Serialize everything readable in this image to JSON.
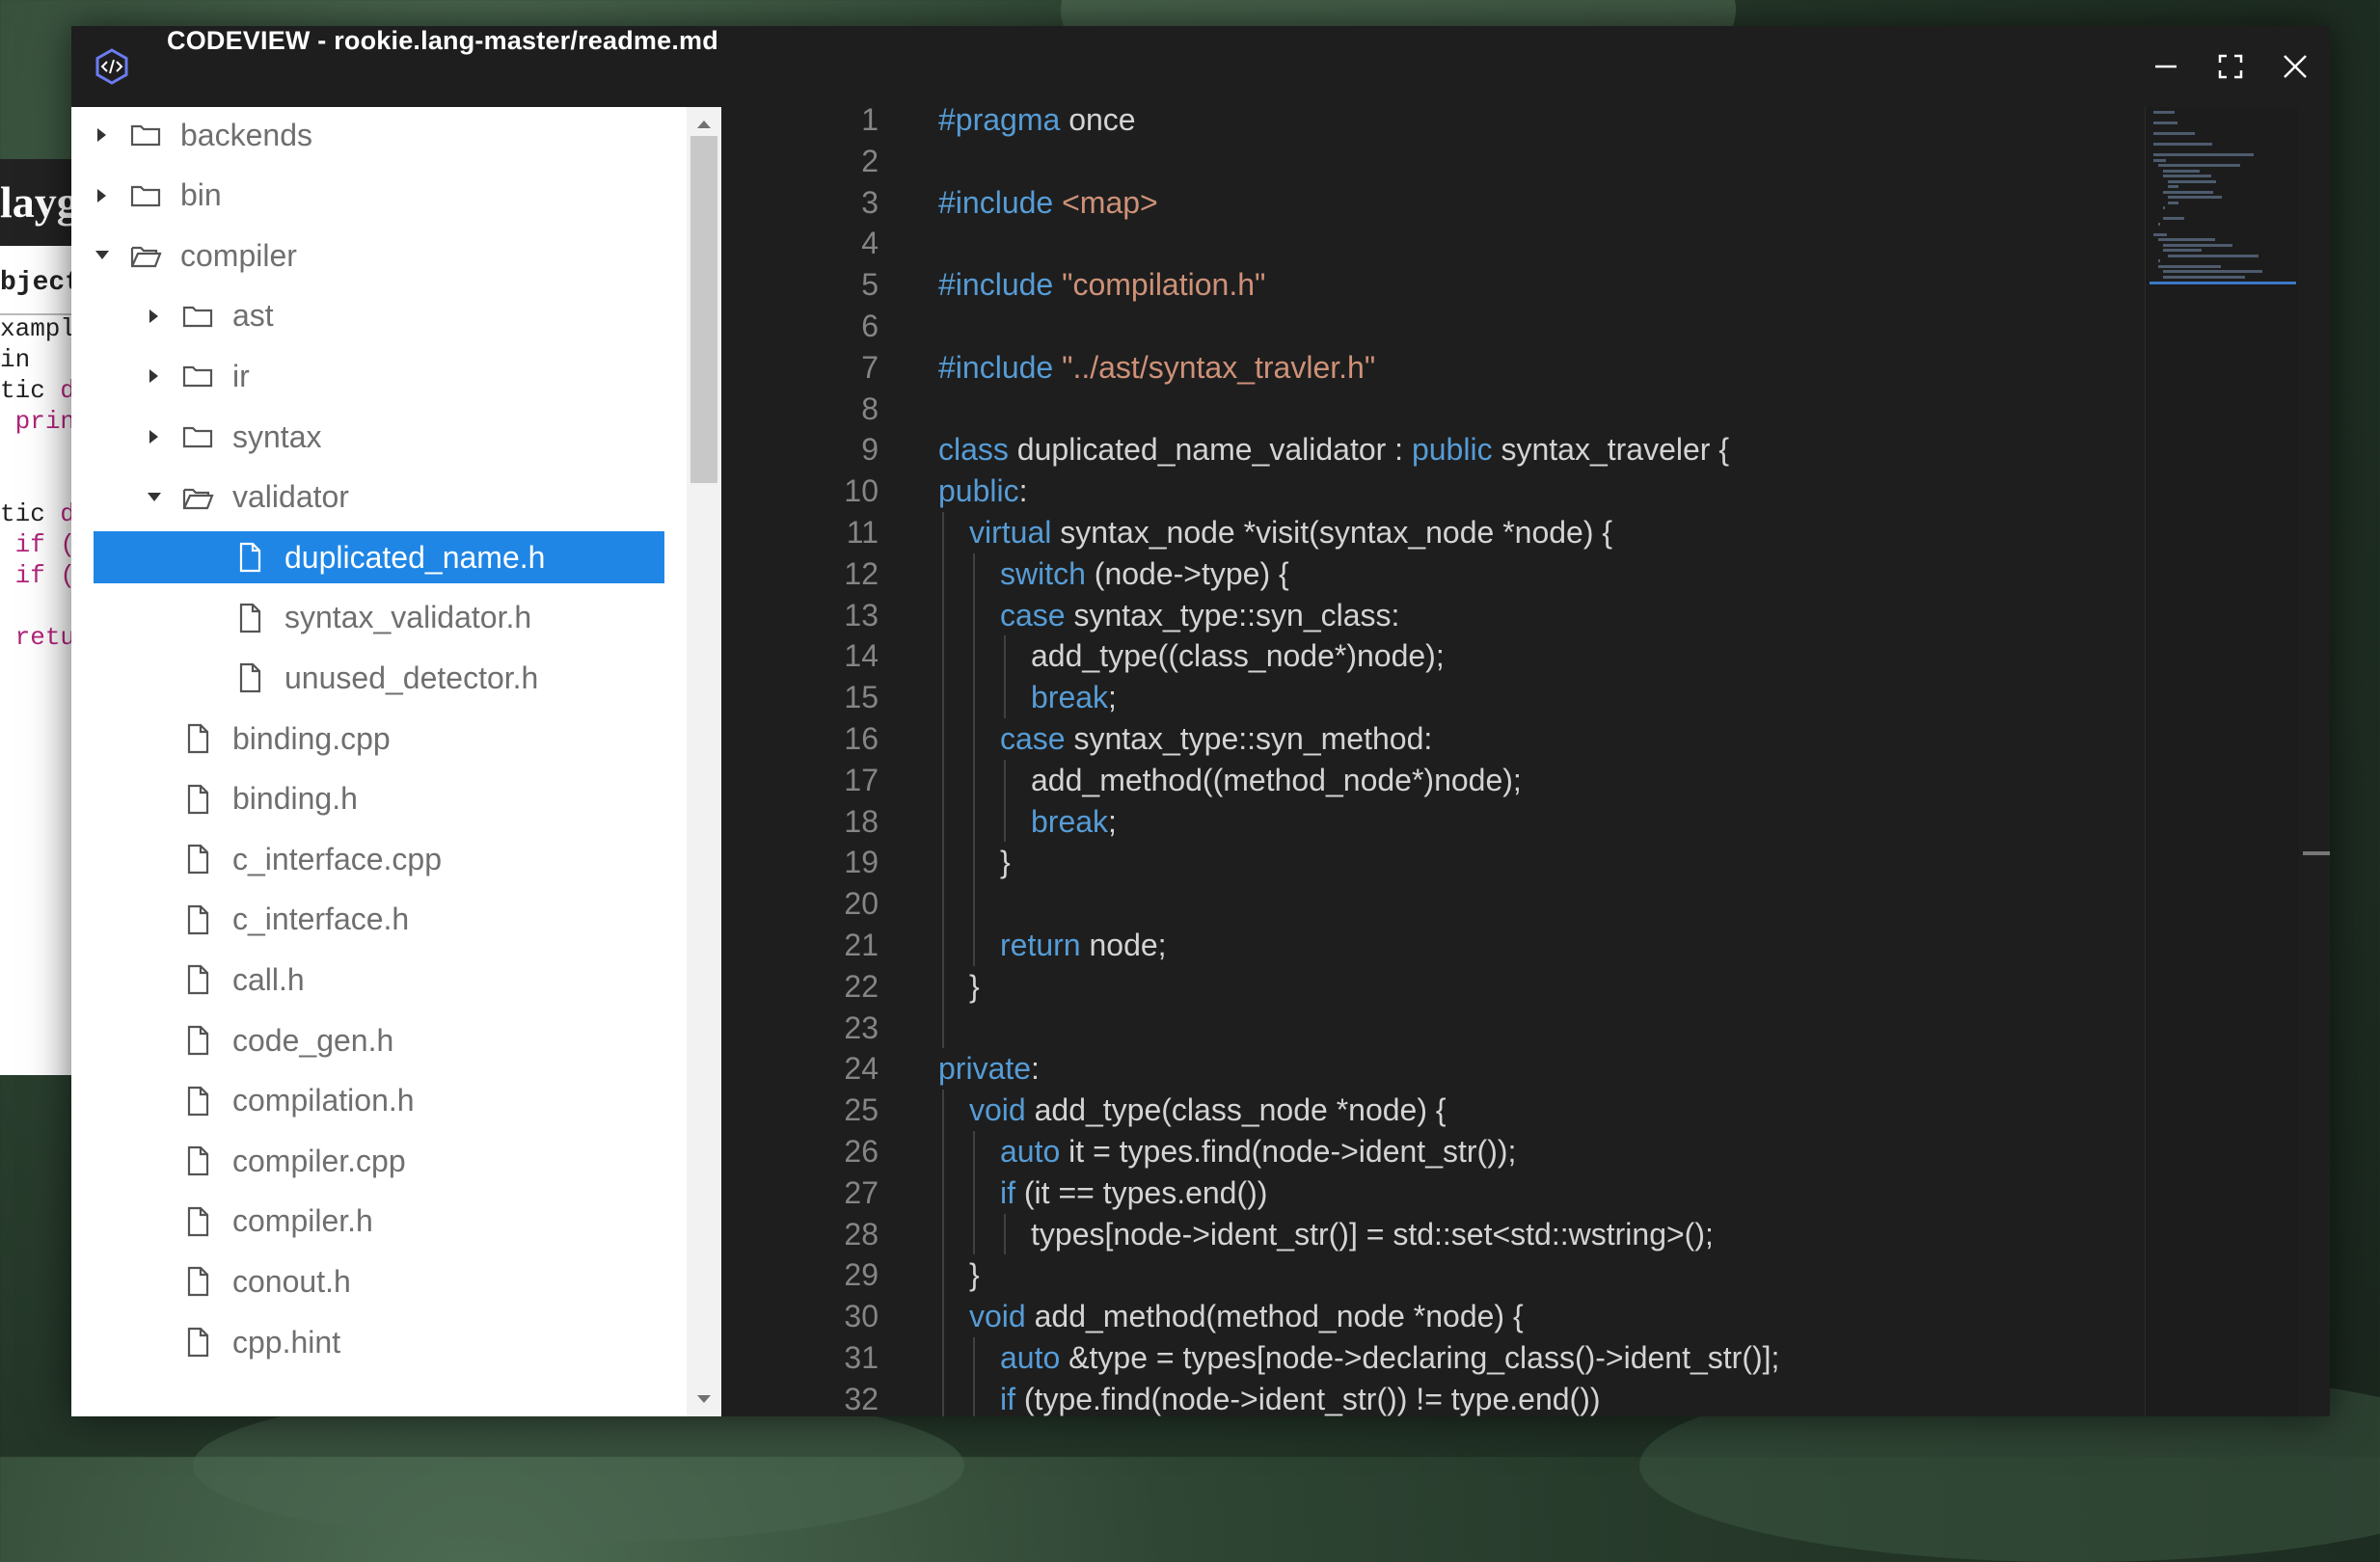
{
  "window": {
    "title": "CODEVIEW - rookie.lang-master/readme.md",
    "app_icon": "code-hexagon-icon",
    "buttons": [
      "minimize-icon",
      "maximize-icon",
      "close-icon"
    ]
  },
  "background_window": {
    "title_fragment": "layg",
    "tab_fragment": "bject",
    "code_lines": [
      {
        "a": "xampl",
        "b": ""
      },
      {
        "a": "in",
        "b": ""
      },
      {
        "a": "tic ",
        "b": "d"
      },
      {
        "a": " ",
        "b": "prin"
      },
      {
        "a": "",
        "b": ""
      },
      {
        "a": "",
        "b": ""
      },
      {
        "a": "tic ",
        "b": "d"
      },
      {
        "a": " ",
        "b": "if ("
      },
      {
        "a": " ",
        "b": "if ("
      },
      {
        "a": "",
        "b": ""
      },
      {
        "a": " ",
        "b": "retu"
      }
    ]
  },
  "file_tree": {
    "items": [
      {
        "label": "backends",
        "type": "folder",
        "expanded": false,
        "depth": 0
      },
      {
        "label": "bin",
        "type": "folder",
        "expanded": false,
        "depth": 0
      },
      {
        "label": "compiler",
        "type": "folder",
        "expanded": true,
        "depth": 0
      },
      {
        "label": "ast",
        "type": "folder",
        "expanded": false,
        "depth": 1
      },
      {
        "label": "ir",
        "type": "folder",
        "expanded": false,
        "depth": 1
      },
      {
        "label": "syntax",
        "type": "folder",
        "expanded": false,
        "depth": 1
      },
      {
        "label": "validator",
        "type": "folder",
        "expanded": true,
        "depth": 1
      },
      {
        "label": "duplicated_name.h",
        "type": "file",
        "depth": 2,
        "selected": true
      },
      {
        "label": "syntax_validator.h",
        "type": "file",
        "depth": 2
      },
      {
        "label": "unused_detector.h",
        "type": "file",
        "depth": 2
      },
      {
        "label": "binding.cpp",
        "type": "file",
        "depth": 1
      },
      {
        "label": "binding.h",
        "type": "file",
        "depth": 1
      },
      {
        "label": "c_interface.cpp",
        "type": "file",
        "depth": 1
      },
      {
        "label": "c_interface.h",
        "type": "file",
        "depth": 1
      },
      {
        "label": "call.h",
        "type": "file",
        "depth": 1
      },
      {
        "label": "code_gen.h",
        "type": "file",
        "depth": 1
      },
      {
        "label": "compilation.h",
        "type": "file",
        "depth": 1
      },
      {
        "label": "compiler.cpp",
        "type": "file",
        "depth": 1
      },
      {
        "label": "compiler.h",
        "type": "file",
        "depth": 1
      },
      {
        "label": "conout.h",
        "type": "file",
        "depth": 1
      },
      {
        "label": "cpp.hint",
        "type": "file",
        "depth": 1
      }
    ]
  },
  "editor": {
    "lines": [
      {
        "n": "1",
        "indent": 0,
        "tokens": [
          [
            "kw",
            "#pragma"
          ],
          [
            "txt",
            " once"
          ]
        ]
      },
      {
        "n": "2",
        "indent": 0,
        "tokens": []
      },
      {
        "n": "3",
        "indent": 0,
        "tokens": [
          [
            "kw",
            "#include"
          ],
          [
            "txt",
            " "
          ],
          [
            "str",
            "<map>"
          ]
        ]
      },
      {
        "n": "4",
        "indent": 0,
        "tokens": []
      },
      {
        "n": "5",
        "indent": 0,
        "tokens": [
          [
            "kw",
            "#include"
          ],
          [
            "txt",
            " "
          ],
          [
            "str",
            "\"compilation.h\""
          ]
        ]
      },
      {
        "n": "6",
        "indent": 0,
        "tokens": []
      },
      {
        "n": "7",
        "indent": 0,
        "tokens": [
          [
            "kw",
            "#include"
          ],
          [
            "txt",
            " "
          ],
          [
            "str",
            "\"../ast/syntax_travler.h\""
          ]
        ]
      },
      {
        "n": "8",
        "indent": 0,
        "tokens": []
      },
      {
        "n": "9",
        "indent": 0,
        "tokens": [
          [
            "kw",
            "class"
          ],
          [
            "txt",
            " duplicated_name_validator : "
          ],
          [
            "kw",
            "public"
          ],
          [
            "txt",
            " syntax_traveler {"
          ]
        ]
      },
      {
        "n": "10",
        "indent": 0,
        "tokens": [
          [
            "kw",
            "public"
          ],
          [
            "txt",
            ":"
          ]
        ]
      },
      {
        "n": "11",
        "indent": 1,
        "tokens": [
          [
            "kw",
            "virtual"
          ],
          [
            "txt",
            " syntax_node *visit(syntax_node *node) {"
          ]
        ]
      },
      {
        "n": "12",
        "indent": 2,
        "tokens": [
          [
            "kw",
            "switch"
          ],
          [
            "txt",
            " (node->type) {"
          ]
        ]
      },
      {
        "n": "13",
        "indent": 2,
        "tokens": [
          [
            "kw",
            "case"
          ],
          [
            "txt",
            " syntax_type::syn_class:"
          ]
        ]
      },
      {
        "n": "14",
        "indent": 3,
        "tokens": [
          [
            "txt",
            "add_type((class_node*)node);"
          ]
        ]
      },
      {
        "n": "15",
        "indent": 3,
        "tokens": [
          [
            "kw",
            "break"
          ],
          [
            "txt",
            ";"
          ]
        ]
      },
      {
        "n": "16",
        "indent": 2,
        "tokens": [
          [
            "kw",
            "case"
          ],
          [
            "txt",
            " syntax_type::syn_method:"
          ]
        ]
      },
      {
        "n": "17",
        "indent": 3,
        "tokens": [
          [
            "txt",
            "add_method((method_node*)node);"
          ]
        ]
      },
      {
        "n": "18",
        "indent": 3,
        "tokens": [
          [
            "kw",
            "break"
          ],
          [
            "txt",
            ";"
          ]
        ]
      },
      {
        "n": "19",
        "indent": 2,
        "tokens": [
          [
            "txt",
            "}"
          ]
        ]
      },
      {
        "n": "20",
        "indent": 2,
        "tokens": []
      },
      {
        "n": "21",
        "indent": 2,
        "tokens": [
          [
            "kw",
            "return"
          ],
          [
            "txt",
            " node;"
          ]
        ]
      },
      {
        "n": "22",
        "indent": 1,
        "tokens": [
          [
            "txt",
            "}"
          ]
        ]
      },
      {
        "n": "23",
        "indent": 1,
        "tokens": []
      },
      {
        "n": "24",
        "indent": 0,
        "tokens": [
          [
            "kw",
            "private"
          ],
          [
            "txt",
            ":"
          ]
        ]
      },
      {
        "n": "25",
        "indent": 1,
        "tokens": [
          [
            "kw",
            "void"
          ],
          [
            "txt",
            " add_type(class_node *node) {"
          ]
        ]
      },
      {
        "n": "26",
        "indent": 2,
        "tokens": [
          [
            "kw",
            "auto"
          ],
          [
            "txt",
            " it = types.find(node->ident_str());"
          ]
        ]
      },
      {
        "n": "27",
        "indent": 2,
        "tokens": [
          [
            "kw",
            "if"
          ],
          [
            "txt",
            " (it == types.end())"
          ]
        ]
      },
      {
        "n": "28",
        "indent": 3,
        "tokens": [
          [
            "txt",
            "types[node->ident_str()] = std::set<std::wstring>();"
          ]
        ]
      },
      {
        "n": "29",
        "indent": 1,
        "tokens": [
          [
            "txt",
            "}"
          ]
        ]
      },
      {
        "n": "30",
        "indent": 1,
        "tokens": [
          [
            "kw",
            "void"
          ],
          [
            "txt",
            " add_method(method_node *node) {"
          ]
        ]
      },
      {
        "n": "31",
        "indent": 2,
        "tokens": [
          [
            "kw",
            "auto"
          ],
          [
            "txt",
            " &type = types[node->declaring_class()->ident_str()];"
          ]
        ]
      },
      {
        "n": "32",
        "indent": 2,
        "tokens": [
          [
            "kw",
            "if"
          ],
          [
            "txt",
            " (type.find(node->ident_str()) != type.end())"
          ]
        ]
      }
    ]
  },
  "colors": {
    "selection": "#1f86e6",
    "keyword": "#569cd6",
    "string": "#ce9178",
    "text": "#d4d4d4",
    "line_number": "#858585",
    "editor_bg": "#1e1e1e"
  }
}
